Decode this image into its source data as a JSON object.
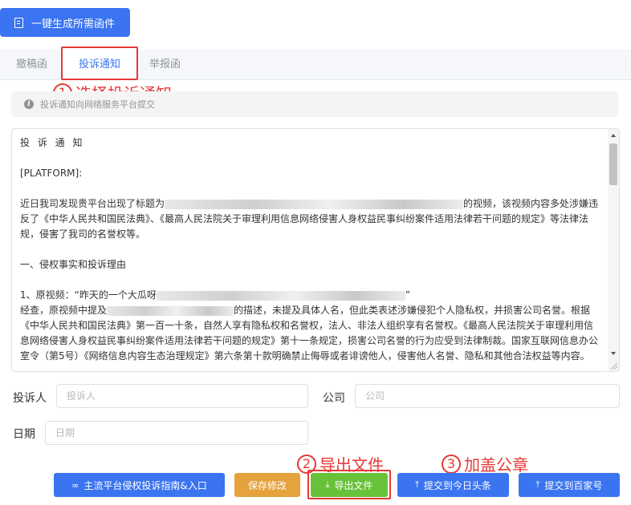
{
  "toolbar": {
    "generate_label": "一键生成所需函件",
    "generate_icon": "document-icon"
  },
  "tabs": [
    {
      "label": "撤稿函",
      "active": false
    },
    {
      "label": "投诉通知",
      "active": true
    },
    {
      "label": "举报函",
      "active": false
    }
  ],
  "annotations": {
    "step1": {
      "num": "1",
      "text": "选择投诉通知"
    },
    "step2": {
      "num": "2",
      "text": "导出文件"
    },
    "step3": {
      "num": "3",
      "text": "加盖公章"
    },
    "color": "#e53935"
  },
  "info": {
    "text": "投诉通知向网络服务平台提交",
    "icon": "info-icon"
  },
  "letter": {
    "title": "投 诉 通 知",
    "platform": "[PLATFORM]:",
    "p1_a": "近日我司发现贵平台出现了标题为",
    "p1_b": "的视频，该视频内容多处涉嫌违反了《中华人民共和国民法典》、《最高人民法院关于审理利用信息网络侵害人身权益民事纠纷案件适用法律若干问题的规定》等法律法规，侵害了我司的名誉权等。",
    "section1": "一、侵权事实和投诉理由",
    "item1_a": "1、原视频：“昨天的一个大瓜呀",
    "item1_b": "”",
    "p2_a": "经查，原视频中提及",
    "p2_b": "的描述，未提及具体人名，但此类表述涉嫌侵犯个人隐私权，并损害公司名誉。根据《中华人民共和国民法典》第一百一十条，自然人享有隐私权和名誉权，法人、非法人组织享有名誉权。《最高人民法院关于审理利用信息网络侵害人身权益民事纠纷案件适用法律若干问题的规定》第十一条规定，损害公司名誉的行为应受到法律制裁。国家互联网信息办公室令（第5号）《网络信息内容生态治理规定》第六条第十款明确禁止侮辱或者诽谤他人，侵害他人名誉、隐私和其他合法权益等内容。"
  },
  "form": {
    "complainant_label": "投诉人",
    "complainant_placeholder": "投诉人",
    "complainant_value": "",
    "company_label": "公司",
    "company_placeholder": "公司",
    "company_value": "",
    "date_label": "日期",
    "date_placeholder": "日期",
    "date_value": ""
  },
  "actions": {
    "guide": {
      "label": "主流平台侵权投诉指南&入口",
      "icon": "link-icon"
    },
    "save": {
      "label": "保存修改"
    },
    "export": {
      "label": "导出文件",
      "icon": "download-icon"
    },
    "toutiao": {
      "label": "提交到今日头条",
      "icon": "upload-icon"
    },
    "baijia": {
      "label": "提交到百家号",
      "icon": "upload-icon"
    }
  },
  "colors": {
    "primary": "#3a74f0",
    "warning": "#e6a23c",
    "success": "#67c23a",
    "annotation": "#e53935"
  }
}
